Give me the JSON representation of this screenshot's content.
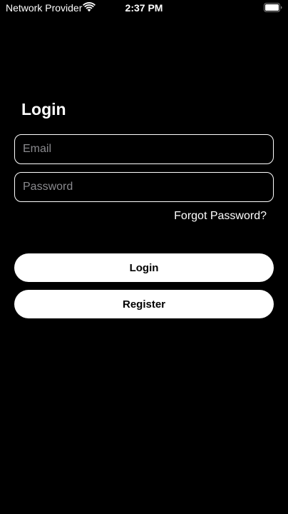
{
  "status_bar": {
    "carrier": "Network Provider",
    "time": "2:37 PM",
    "icons": [
      "wifi-icon",
      "battery-icon"
    ]
  },
  "login": {
    "title": "Login",
    "email": {
      "placeholder": "Email",
      "value": ""
    },
    "password": {
      "placeholder": "Password",
      "value": ""
    },
    "forgot_password_label": "Forgot Password?",
    "login_button_label": "Login",
    "register_button_label": "Register"
  },
  "colors": {
    "background": "#000000",
    "foreground": "#ffffff",
    "placeholder": "#8a8a8e",
    "button_text": "#000000"
  }
}
